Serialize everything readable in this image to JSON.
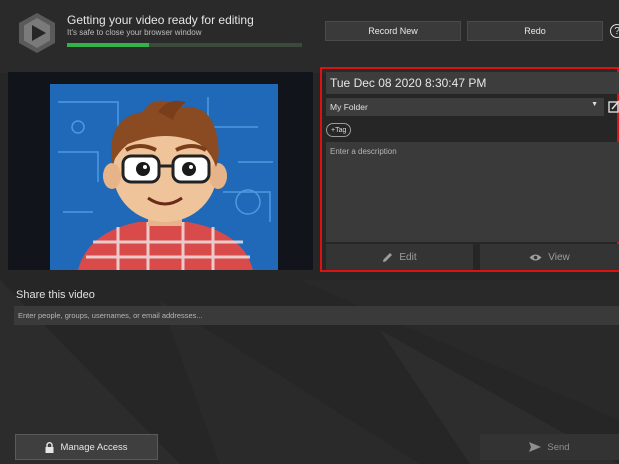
{
  "status": {
    "title": "Getting your video ready for editing",
    "subtitle": "It's safe to close your browser window",
    "progress_fraction": 0.35
  },
  "header": {
    "record_new_label": "Record New",
    "redo_label": "Redo",
    "help_glyph": "?"
  },
  "details": {
    "title": "Tue Dec 08 2020 8:30:47 PM",
    "folder": "My Folder",
    "tag_label": "+Tag",
    "description_placeholder": "Enter a description",
    "edit_label": "Edit",
    "view_label": "View"
  },
  "share": {
    "heading": "Share this video",
    "input_placeholder": "Enter people, groups, usernames, or email addresses...",
    "manage_access_label": "Manage Access",
    "send_label": "Send"
  },
  "colors": {
    "background": "#262626",
    "panel": "#3a3a3a",
    "progress_fill": "#34b24a",
    "highlight_border": "#dd1111"
  },
  "icons": [
    "app-logo-icon",
    "help-icon",
    "edit-folder-icon",
    "pencil-icon",
    "eye-icon",
    "lock-icon",
    "send-arrow-icon",
    "dropdown-caret-icon"
  ]
}
